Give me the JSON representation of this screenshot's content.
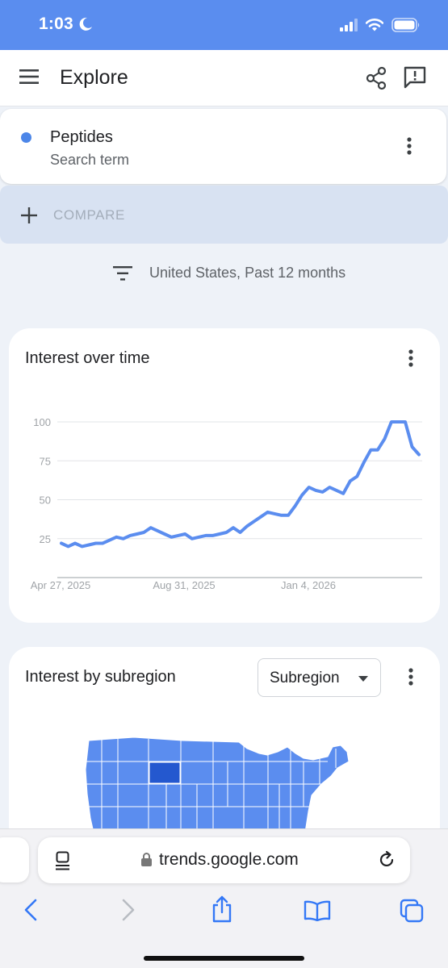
{
  "status_bar": {
    "time": "1:03",
    "icons": [
      "moon-icon",
      "signal-icon",
      "wifi-icon",
      "battery-icon"
    ]
  },
  "header": {
    "title": "Explore",
    "icons": [
      "menu-icon",
      "share-icon",
      "feedback-icon"
    ]
  },
  "search_term": {
    "name": "Peptides",
    "subtitle": "Search term",
    "color": "#4c86e8"
  },
  "compare": {
    "label": "COMPARE"
  },
  "filters": {
    "label": "United States, Past 12 months"
  },
  "interest_over_time": {
    "title": "Interest over time"
  },
  "chart_data": {
    "type": "line",
    "title": "",
    "xlabel": "",
    "ylabel": "",
    "ylim": [
      0,
      100
    ],
    "y_ticks": [
      "25",
      "50",
      "75",
      "100"
    ],
    "x_tick_labels": [
      "Apr 27, 2025",
      "Aug 31, 2025",
      "Jan 4, 2026"
    ],
    "grid": true,
    "series_color": "#5b8def",
    "series": [
      {
        "values": [
          22,
          20,
          22,
          20,
          21,
          22,
          22,
          24,
          26,
          25,
          27,
          28,
          29,
          32,
          30,
          28,
          26,
          27,
          28,
          25,
          26,
          27,
          27,
          28,
          29,
          32,
          29,
          33,
          36,
          39,
          42,
          41,
          40,
          40,
          46,
          53,
          58,
          56,
          55,
          58,
          56,
          54,
          62,
          65,
          74,
          82,
          82,
          89,
          100,
          100,
          100,
          84,
          79
        ]
      }
    ]
  },
  "interest_by_subregion": {
    "title": "Interest by subregion",
    "dropdown_label": "Subregion",
    "map_color": "#5b8def",
    "highlight_color": "#2458cf"
  },
  "browser": {
    "url": "trends.google.com",
    "toolbar_icons": [
      "back-icon",
      "forward-icon",
      "share-icon",
      "bookmarks-icon",
      "tabs-icon"
    ]
  }
}
